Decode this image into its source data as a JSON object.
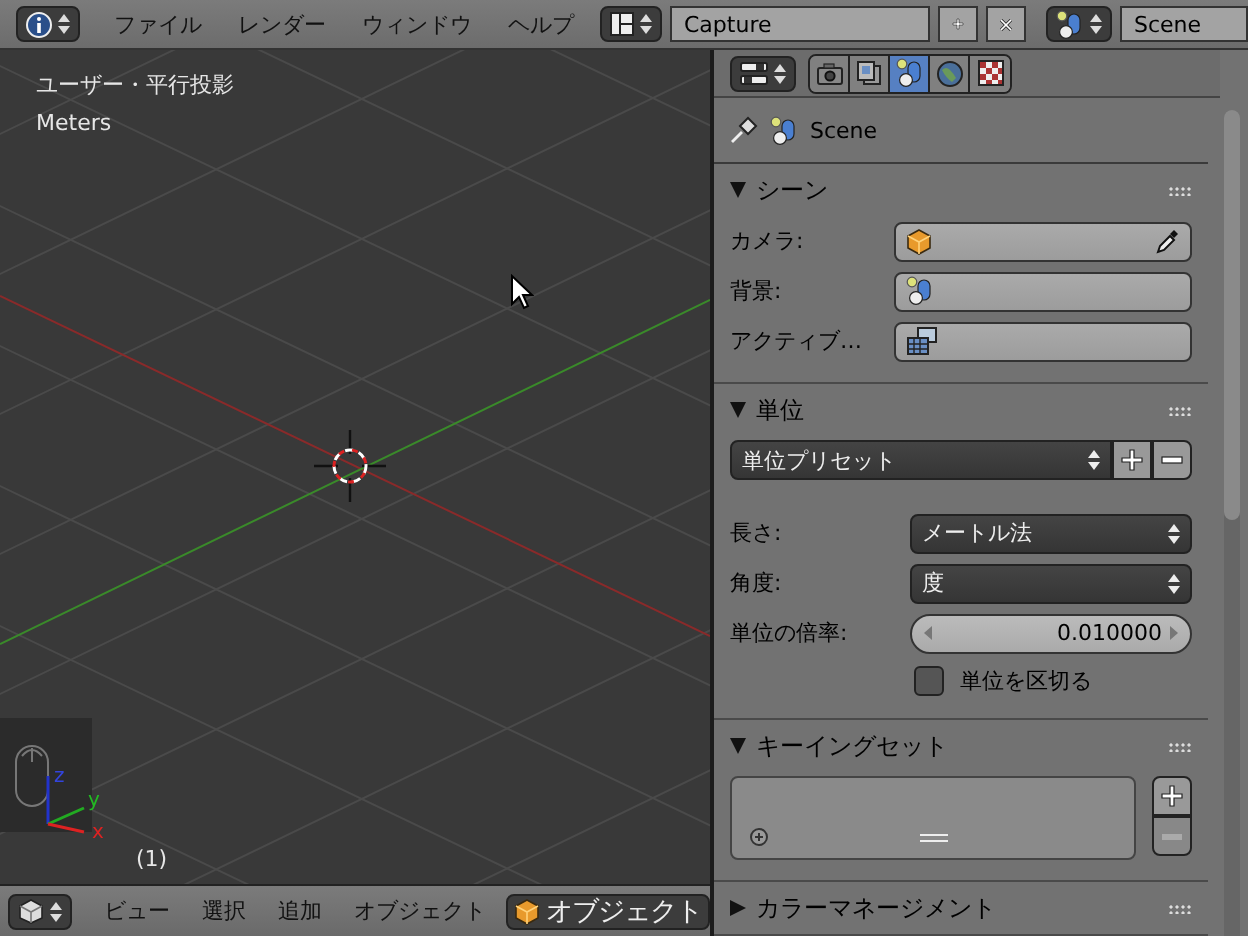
{
  "top_bar": {
    "menus": [
      "ファイル",
      "レンダー",
      "ウィンドウ",
      "ヘルプ"
    ],
    "screen_layout": "Capture",
    "scene": "Scene"
  },
  "viewport": {
    "view_name": "ユーザー・平行投影",
    "units": "Meters",
    "frame": "(1)",
    "axes": [
      "x",
      "y",
      "z"
    ]
  },
  "viewport_header": {
    "menus": [
      "ビュー",
      "選択",
      "追加",
      "オブジェクト"
    ],
    "mode": "オブジェクト"
  },
  "properties": {
    "tabs": [
      {
        "kind": "render",
        "selected": false
      },
      {
        "kind": "layers",
        "selected": false
      },
      {
        "kind": "scene",
        "selected": true
      },
      {
        "kind": "world",
        "selected": false
      },
      {
        "kind": "texture",
        "selected": false
      }
    ],
    "breadcrumb": "Scene",
    "panels": [
      {
        "title": "シーン",
        "expanded": true,
        "rows": [
          {
            "kind": "picker",
            "label": "カメラ:",
            "eyedropper": true
          },
          {
            "kind": "picker",
            "label": "背景:",
            "eyedropper": false
          },
          {
            "kind": "picker",
            "label": "アクティブ…",
            "eyedropper": false
          }
        ]
      },
      {
        "title": "単位",
        "expanded": true,
        "rows": [
          {
            "kind": "preset",
            "value": "単位プリセット"
          },
          {
            "kind": "dropdown",
            "label": "長さ:",
            "value": "メートル法"
          },
          {
            "kind": "dropdown",
            "label": "角度:",
            "value": "度"
          },
          {
            "kind": "number",
            "label": "単位の倍率:",
            "value": "0.010000"
          },
          {
            "kind": "checkbox",
            "label": "単位を区切る",
            "checked": false
          }
        ]
      },
      {
        "title": "キーイングセット",
        "expanded": true,
        "rows": [
          {
            "kind": "list"
          }
        ]
      },
      {
        "title": "カラーマネージメント",
        "expanded": false
      }
    ]
  }
}
